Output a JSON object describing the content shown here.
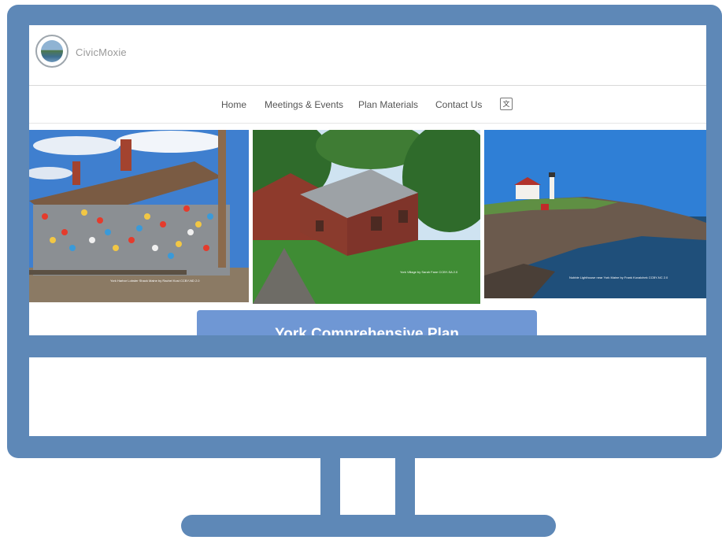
{
  "site": {
    "logo_text": "CivicMoxie"
  },
  "nav": {
    "items": [
      {
        "label": "Home"
      },
      {
        "label": "Meetings & Events"
      },
      {
        "label": "Plan Materials"
      },
      {
        "label": "Contact Us"
      }
    ],
    "translate_icon": "translate-icon"
  },
  "photos": [
    {
      "subject": "lobster-shack-buoys",
      "caption": "York Harbor Lobster Shack Maine by Rachel Kost CCBY-ND 2.0"
    },
    {
      "subject": "red-historic-houses",
      "caption": "York Village by Sarah Fane CCBY-SA 2.0"
    },
    {
      "subject": "nubble-lighthouse",
      "caption": "Nubble Lighthouse near York Maine by Frank Kovalchek CCBY-NC 2.0"
    }
  ],
  "hero": {
    "title": "York Comprehensive Plan"
  },
  "colors": {
    "monitor": "#5e88b7",
    "plan_tab": "#6f97d4"
  }
}
